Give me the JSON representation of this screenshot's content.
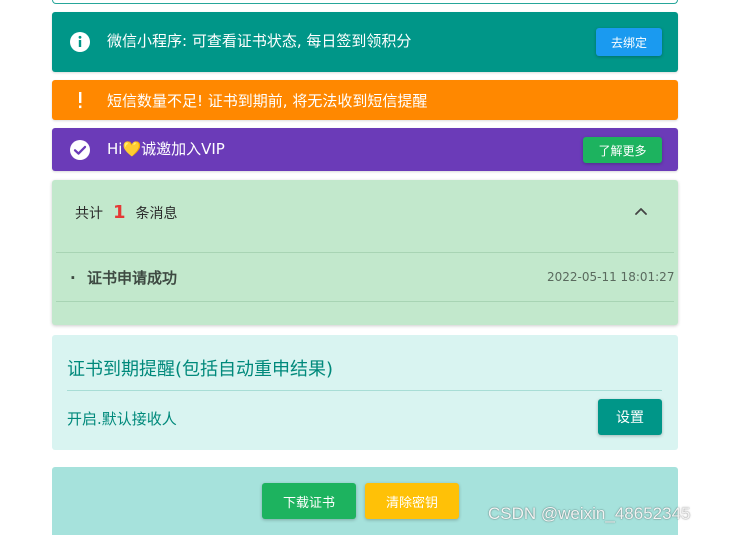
{
  "wechat_bar": {
    "text": "微信小程序: 可查看证书状态, 每日签到领积分",
    "button_label": "去绑定",
    "icon": "info-icon",
    "color": "#009688"
  },
  "sms_bar": {
    "text": "短信数量不足! 证书到期前, 将无法收到短信提醒",
    "icon": "exclamation-icon",
    "color": "#ff8800"
  },
  "vip_bar": {
    "text": "Hi💛诚邀加入VIP",
    "button_label": "了解更多",
    "icon": "check-circle-icon",
    "color": "#6b3bb8"
  },
  "messages": {
    "prefix": "共计",
    "count": "1",
    "suffix": "条消息",
    "toggle_icon": "chevron-up-icon",
    "items": [
      {
        "bullet": "·",
        "title": "证书申请成功",
        "time": "2022-05-11 18:01:27"
      }
    ]
  },
  "expire_reminder": {
    "title": "证书到期提醒(包括自动重申结果)",
    "status": "开启.默认接收人",
    "button_label": "设置"
  },
  "actions": {
    "download_label": "下载证书",
    "clear_label": "清除密钥"
  },
  "watermark": "CSDN @weixin_48652345"
}
